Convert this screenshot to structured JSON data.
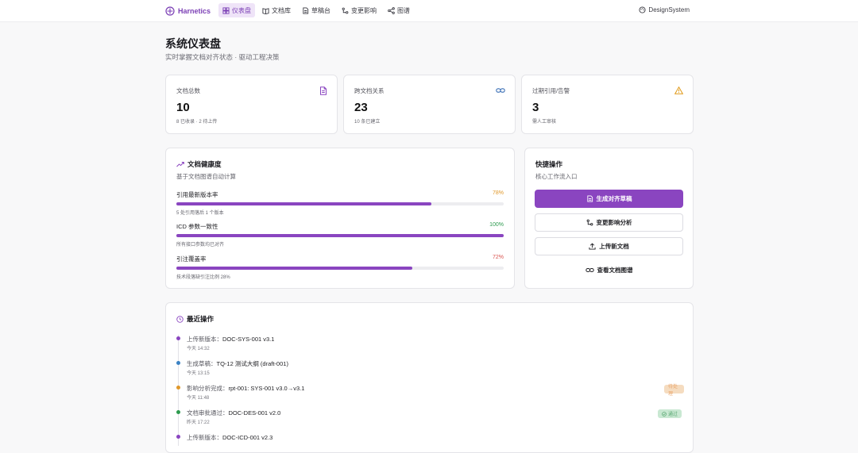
{
  "header": {
    "brand": "Harnetics",
    "nav": [
      {
        "label": "仪表盘",
        "icon": "dashboard-icon",
        "active": true
      },
      {
        "label": "文档库",
        "icon": "book-icon",
        "active": false
      },
      {
        "label": "草稿台",
        "icon": "draft-icon",
        "active": false
      },
      {
        "label": "变更影响",
        "icon": "impact-icon",
        "active": false
      },
      {
        "label": "图谱",
        "icon": "graph-icon",
        "active": false
      }
    ],
    "design_system": "DesignSystem"
  },
  "page": {
    "title": "系统仪表盘",
    "subtitle": "实时掌握文档对齐状态 · 驱动工程决策"
  },
  "stats": [
    {
      "label": "文档总数",
      "value": "10",
      "note": "8 已收录 · 2 待上传",
      "icon": "document-icon",
      "color": "#8a45c0"
    },
    {
      "label": "跨文档关系",
      "value": "23",
      "note": "10 条已建立",
      "icon": "link-icon",
      "color": "#3b6fb6"
    },
    {
      "label": "过期引用/告警",
      "value": "3",
      "note": "需人工审核",
      "icon": "warning-icon",
      "color": "#e09a1a"
    }
  ],
  "health": {
    "title": "文档健康度",
    "subtitle": "基于文档图谱自动计算",
    "metrics": [
      {
        "name": "引用最新版本率",
        "pct": "78%",
        "value": 0.78,
        "note": "5 处引用落后 1 个版本",
        "color": "#e0982a"
      },
      {
        "name": "ICD 参数一致性",
        "pct": "100%",
        "value": 1.0,
        "note": "所有接口参数均已对齐",
        "color": "#2d9a4e"
      },
      {
        "name": "引注覆盖率",
        "pct": "72%",
        "value": 0.72,
        "note": "技术段落缺引注比例 28%",
        "color": "#d9534f"
      }
    ]
  },
  "quick": {
    "title": "快捷操作",
    "subtitle": "核心工作流入口",
    "actions": [
      {
        "label": "生成对齐草稿",
        "icon": "draft-icon",
        "style": "primary"
      },
      {
        "label": "变更影响分析",
        "icon": "impact-icon",
        "style": "outline"
      },
      {
        "label": "上传新文档",
        "icon": "upload-icon",
        "style": "outline"
      },
      {
        "label": "查看文档图谱",
        "icon": "link-icon",
        "style": "ghost"
      }
    ]
  },
  "recent": {
    "title": "最近操作",
    "items": [
      {
        "prefix": "上传新版本：",
        "target": "DOC-SYS-001 v3.1",
        "time": "今天 14:32",
        "dot": "#8a45c0",
        "badge": ""
      },
      {
        "prefix": "生成草稿：",
        "target": "TQ-12 测试大纲 (draft-001)",
        "time": "今天 13:15",
        "dot": "#3b82c4",
        "badge": ""
      },
      {
        "prefix": "影响分析完成：",
        "target": "rpt-001: SYS-001 v3.0→v3.1",
        "time": "今天 11:48",
        "dot": "#e0982a",
        "badge": "待处理"
      },
      {
        "prefix": "文档审批通过：",
        "target": "DOC-DES-001 v2.0",
        "time": "昨天 17:22",
        "dot": "#2d9a4e",
        "badge": "通过"
      },
      {
        "prefix": "上传新版本：",
        "target": "DOC-ICD-001 v2.3",
        "time": "",
        "dot": "#8a45c0",
        "badge": ""
      }
    ]
  }
}
